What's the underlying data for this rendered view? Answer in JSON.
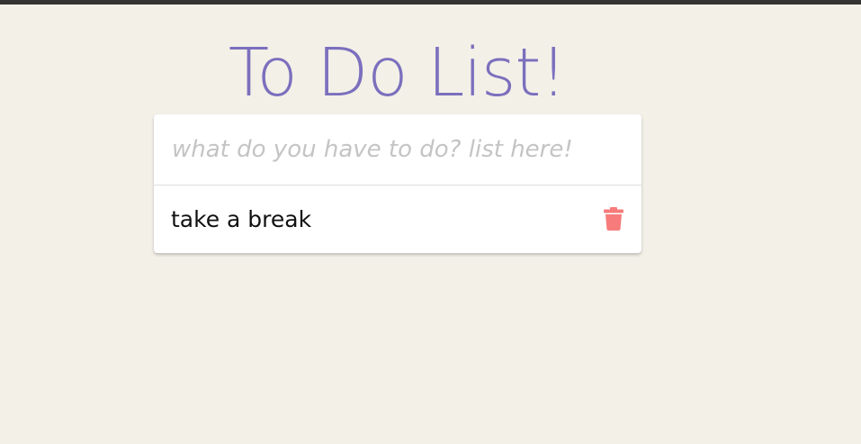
{
  "header": {
    "title": "To Do List!"
  },
  "todo": {
    "input": {
      "value": "",
      "placeholder": "what do you have to do? list here!"
    },
    "items": [
      {
        "label": "take a break",
        "delete_icon": "trash-icon"
      }
    ]
  },
  "colors": {
    "background": "#f3f0e8",
    "title": "#7b6fbd",
    "delete_icon": "#f77b7b",
    "card": "#ffffff"
  }
}
